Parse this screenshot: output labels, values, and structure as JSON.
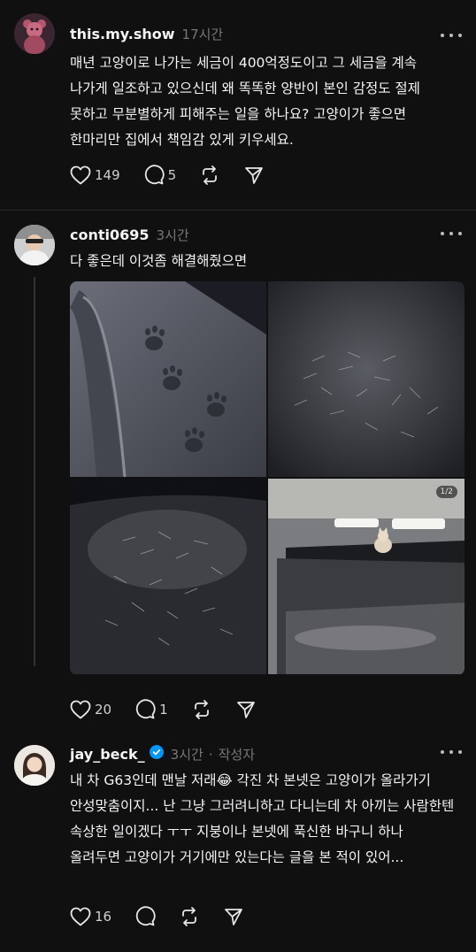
{
  "posts": [
    {
      "username": "this.my.show",
      "time": "17시간",
      "text": "매년 고양이로 나가는 세금이 400억정도이고 그 세금을 계속 나가게 일조하고 있으신데 왜 똑똑한 양반이 본인 감정도 절제 못하고 무분별하게 피해주는 일을 하나요? 고양이가 좋으면 한마리만 집에서 책임감 있게 키우세요.",
      "likes": "149",
      "replies": "5"
    },
    {
      "username": "conti0695",
      "time": "3시간",
      "text": "다 좋은데 이것좀 해결해줬으면",
      "likes": "20",
      "replies": "1",
      "photo_badge": "1/2"
    },
    {
      "username": "jay_beck_",
      "time": "3시간",
      "author_tag": "작성자",
      "text": "내 차 G63인데 맨날 저래😂 각진 차 본넷은 고양이가 올라가기 안성맞춤이지... 난 그냥 그러려니하고 다니는데 차 아끼는 사람한텐 속상한 일이겠다 ㅜㅜ 지붕이나 본넷에 푹신한 바구니 하나 올려두면 고양이가 거기에만 있는다는 글을 본 적이 있어...",
      "likes": "16"
    }
  ],
  "icons": [
    "heart-icon",
    "comment-icon",
    "repost-icon",
    "share-icon",
    "more-icon",
    "verified-badge-icon"
  ],
  "colors": {
    "background": "#101010",
    "text": "#f3f5f7",
    "muted": "#777777",
    "verified": "#0095f6"
  }
}
